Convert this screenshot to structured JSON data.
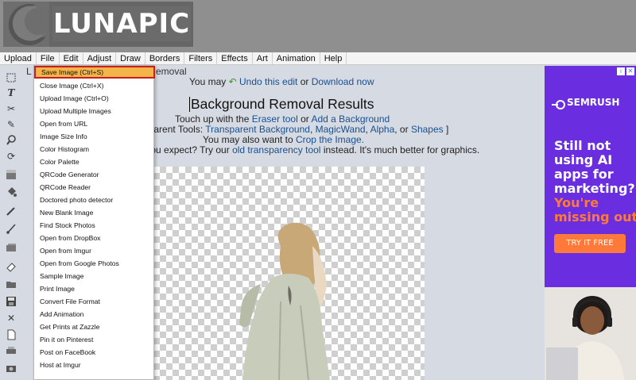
{
  "header": {
    "logo_text": "LUNAPIC"
  },
  "menubar": [
    "Upload",
    "File",
    "Edit",
    "Adjust",
    "Draw",
    "Borders",
    "Filters",
    "Effects",
    "Art",
    "Animation",
    "Help"
  ],
  "file_menu": [
    "Save Image (Ctrl+S)",
    "Close Image (Ctrl+X)",
    "Upload Image (Ctrl+O)",
    "Upload Multiple Images",
    "Open from URL",
    "Image Size Info",
    "Color Histogram",
    "Color Palette",
    "QRCode Generator",
    "QRCode Reader",
    "Doctored photo detector",
    "New Blank Image",
    "Find Stock Photos",
    "Open from DropBox",
    "Open from Imgur",
    "Open from Google Photos",
    "Sample Image",
    "Print Image",
    "Convert File Format",
    "Add Animation",
    "Get Prints at Zazzle",
    "Pin it on Pinterest",
    "Post on FaceBook",
    "Host at Imgur"
  ],
  "main": {
    "breadcrumb_prefix": "L",
    "breadcrumb_suffix": "emoval",
    "undo_prefix": "You may",
    "undo_link": "Undo this edit",
    "undo_or": "or",
    "download_link": "Download now",
    "title": "Background Removal Results",
    "touchup_prefix": "Touch up with the",
    "eraser_link": "Eraser tool",
    "touchup_or": "or",
    "add_bg_link": "Add a Background",
    "transparent_prefix": "nsparent Tools:",
    "transparent_bg_link": "Transparent Background",
    "comma1": ",",
    "magicwand_link": "MagicWand",
    "comma2": ",",
    "alpha_link": "Alpha",
    "or_shapes": ", or",
    "shapes_link": "Shapes",
    "close_bracket": "]",
    "crop_prefix": "You may also want to",
    "crop_link": "Crop the Image.",
    "expect_prefix": "y you expect? Try our",
    "old_tool_link": "old transparency tool",
    "expect_suffix": "instead. It's much better for graphics."
  },
  "ad": {
    "brand": "SEMRUSH",
    "headline_lines": [
      "Still not",
      "using AI",
      "apps for",
      "marketing?"
    ],
    "accent_lines": [
      "You're",
      "missing out!"
    ],
    "cta": "TRY IT FREE",
    "accent_color": "#ff7a3a",
    "bg_color": "#6a2ee0"
  }
}
